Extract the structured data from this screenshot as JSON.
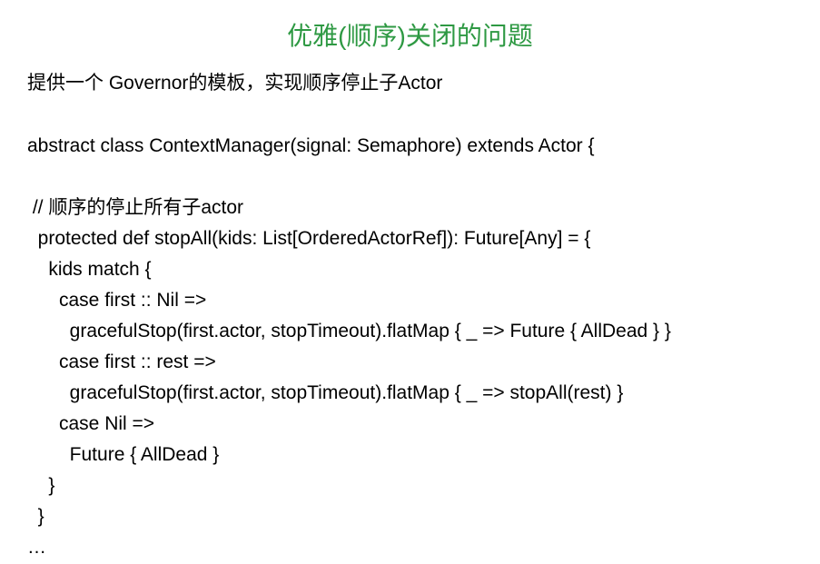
{
  "slide": {
    "title": "优雅(顺序)关闭的问题",
    "description": "提供一个 Governor的模板，实现顺序停止子Actor",
    "code": {
      "line1": "abstract class ContextManager(signal: Semaphore) extends Actor {",
      "line2": "",
      "line3": " // 顺序的停止所有子actor",
      "line4": "  protected def stopAll(kids: List[OrderedActorRef]): Future[Any] = {",
      "line5": "    kids match {",
      "line6": "      case first :: Nil =>",
      "line7": "        gracefulStop(first.actor, stopTimeout).flatMap { _ => Future { AllDead } }",
      "line8": "      case first :: rest =>",
      "line9": "        gracefulStop(first.actor, stopTimeout).flatMap { _ => stopAll(rest) }",
      "line10": "      case Nil =>",
      "line11": "        Future { AllDead }",
      "line12": "    }",
      "line13": "  }",
      "line14": "…"
    }
  }
}
